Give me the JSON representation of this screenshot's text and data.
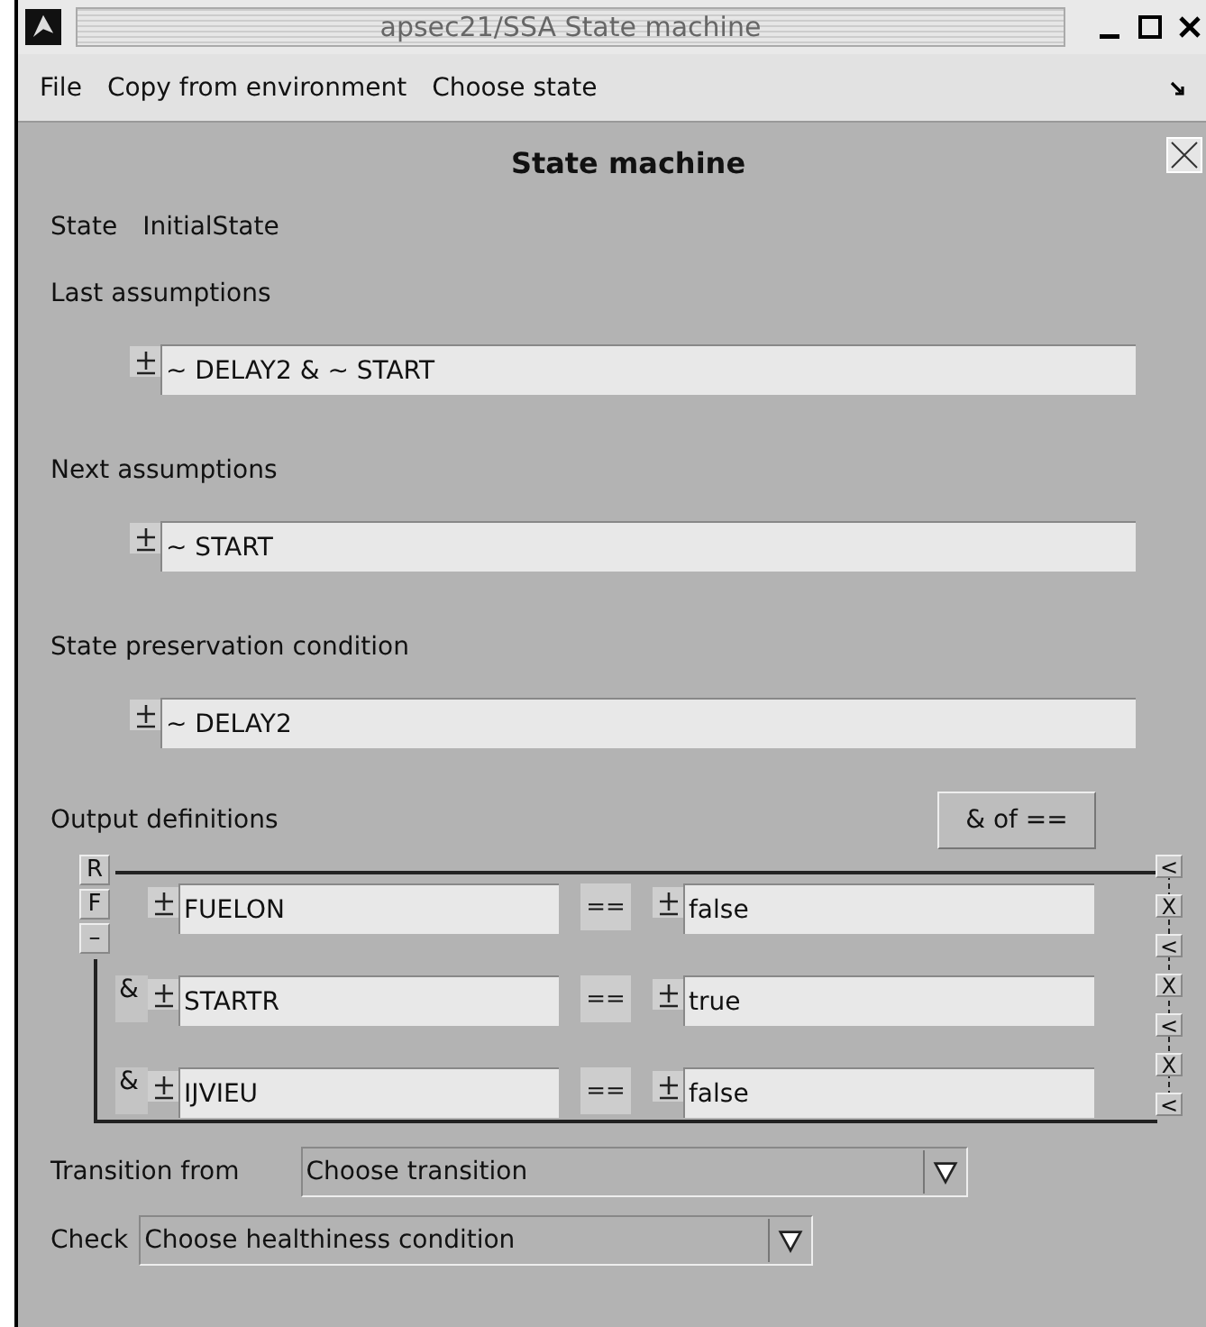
{
  "window": {
    "title": "apsec21/SSA State machine"
  },
  "menu": [
    "File",
    "Copy from environment",
    "Choose state"
  ],
  "panel": {
    "title": "State machine"
  },
  "state": {
    "label": "State",
    "value": "InitialState"
  },
  "sections": [
    {
      "label": "Last assumptions",
      "value": "~ DELAY2 & ~ START"
    },
    {
      "label": "Next assumptions",
      "value": "~ START"
    },
    {
      "label": "State preservation condition",
      "value": "~ DELAY2"
    }
  ],
  "outputs": {
    "label": "Output definitions",
    "button": "& of ==",
    "controls": [
      "R",
      "F",
      "–"
    ],
    "append_label": "<",
    "rows": [
      {
        "prefix": "",
        "name": "FUELON",
        "operator": "==",
        "value": "false",
        "insert_label": "<",
        "remove_label": "X"
      },
      {
        "prefix": "&",
        "name": "STARTR",
        "operator": "==",
        "value": "true",
        "insert_label": "<",
        "remove_label": "X"
      },
      {
        "prefix": "&",
        "name": "IJVIEU",
        "operator": "==",
        "value": "false",
        "insert_label": "<",
        "remove_label": "X"
      }
    ]
  },
  "dropdowns": [
    {
      "label": "Transition from",
      "value": "Choose transition"
    },
    {
      "label": "Check",
      "value": "Choose healthiness condition"
    }
  ]
}
